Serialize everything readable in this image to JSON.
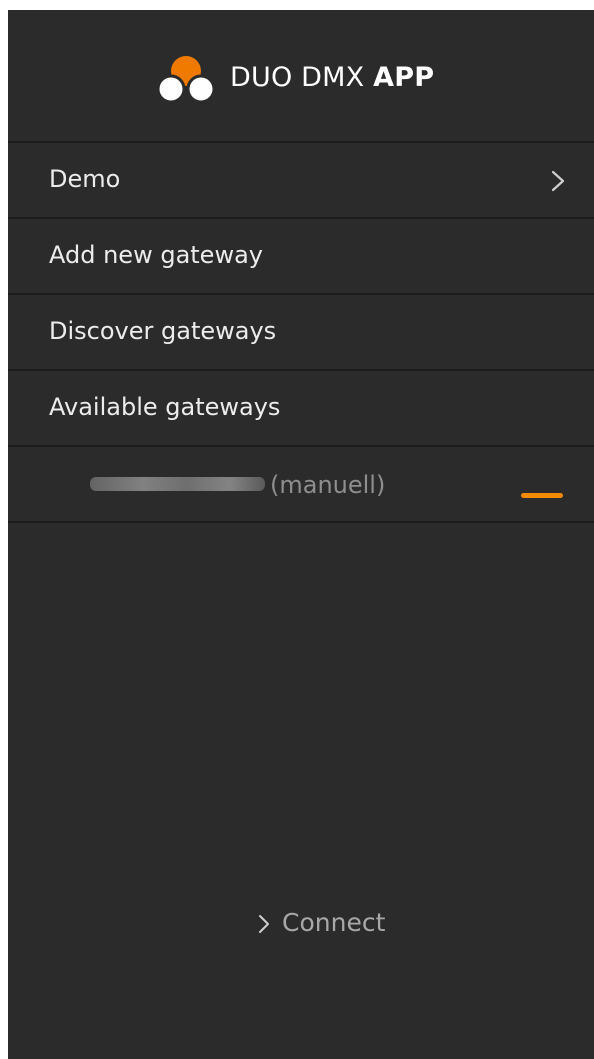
{
  "app": {
    "title_light": "DUO DMX ",
    "title_bold": "APP"
  },
  "colors": {
    "background": "#2b2b2b",
    "divider": "#1c1c1c",
    "accent": "#f28b00",
    "text": "#ececec",
    "muted_text": "#8e8e8e"
  },
  "menu": {
    "items": [
      {
        "label": "Demo",
        "icon": "chevron-right-icon"
      },
      {
        "label": "Add new gateway"
      },
      {
        "label": "Discover gateways"
      },
      {
        "label": "Available gateways"
      }
    ]
  },
  "gateways": [
    {
      "type_label": "(manuell)",
      "action_icon": "minus-icon"
    }
  ],
  "footer": {
    "connect_label": "Connect",
    "connect_icon": "chevron-right-icon"
  }
}
